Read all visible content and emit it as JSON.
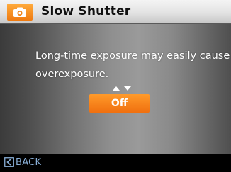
{
  "header": {
    "mode_icon": "camera-icon",
    "title": "Slow Shutter",
    "colors": {
      "badge": "#f5891f",
      "bar": "#e6e6e6"
    }
  },
  "main": {
    "message_lines": [
      "Long-time exposure may easily cause",
      "overexposure."
    ],
    "arrows_icon": "up-down-arrows-icon",
    "option": {
      "value": "Off",
      "color": "#f58a1f"
    }
  },
  "footer": {
    "back_icon": "back-arrow-icon",
    "back_label": "BACK"
  }
}
